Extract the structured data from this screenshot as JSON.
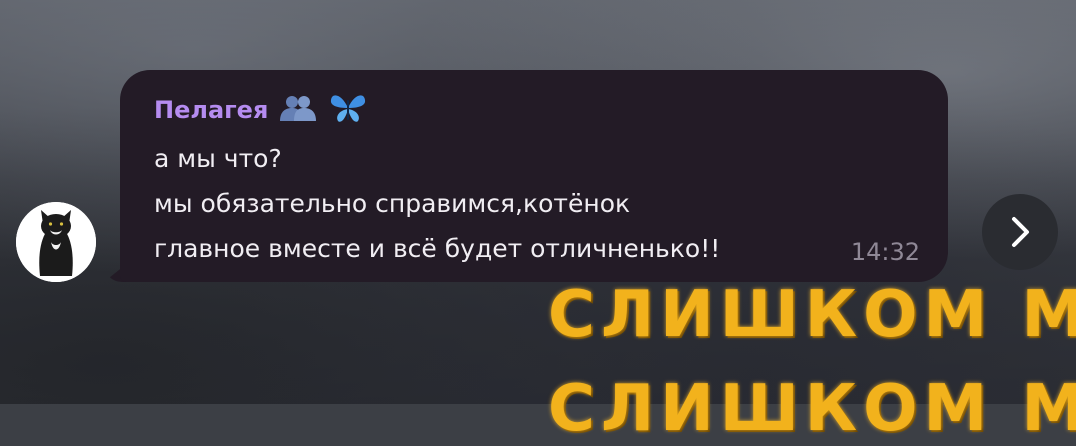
{
  "message": {
    "sender": "Пелагея",
    "sender_emojis": [
      "people-hugging",
      "butterfly"
    ],
    "lines": [
      "а мы что?",
      "мы обязательно справимся,котёнок",
      "главное вместе и всё будет отличненько!!"
    ],
    "time": "14:32"
  },
  "background_text": {
    "line1": "СЛИШКОМ М",
    "line2": "СЛИШКОМ М"
  },
  "colors": {
    "bubble": "#231b26",
    "sender": "#b58cf0",
    "text": "#f1eef3",
    "time": "#8f8896",
    "overlay": "#f2b21c"
  },
  "icons": {
    "avatar": "cat-avatar",
    "next": "chevron-right-icon"
  }
}
